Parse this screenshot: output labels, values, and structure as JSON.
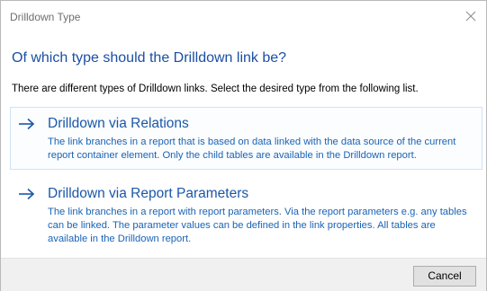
{
  "window": {
    "title": "Drilldown Type",
    "close_icon": "close-icon"
  },
  "main": {
    "heading": "Of which type should the Drilldown link be?",
    "instruction": "There are different types of Drilldown links. Select the desired type from the following list."
  },
  "options": [
    {
      "icon": "arrow-right-icon",
      "title": "Drilldown via Relations",
      "description": "The link branches in a report that is based on data linked with the data source of the current report container element. Only the child tables are available in the Drilldown report."
    },
    {
      "icon": "arrow-right-icon",
      "title": "Drilldown via Report Parameters",
      "description": "The link branches in a report with report parameters. Via the report parameters e.g. any tables can be linked. The parameter values can be defined in the link properties. All tables are available in the Drilldown report."
    }
  ],
  "footer": {
    "cancel_label": "Cancel"
  },
  "colors": {
    "accent": "#1a57a8",
    "link_text": "#1a63b5",
    "hover_border": "#cfe3f5",
    "footer_bg": "#f0f0f0"
  }
}
